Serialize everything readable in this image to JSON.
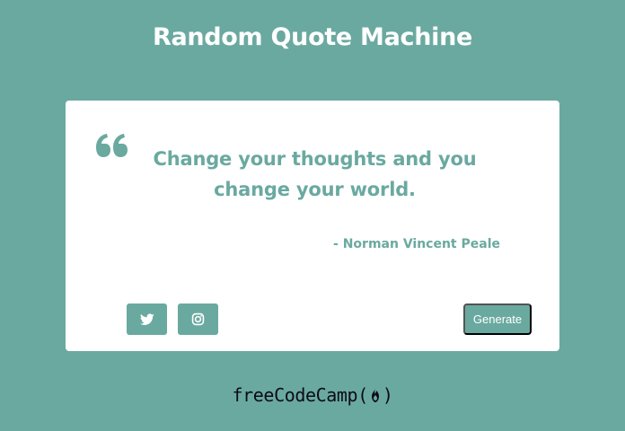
{
  "app": {
    "title": "Random Quote Machine"
  },
  "quote": {
    "text": "Change your thoughts and you change your world.",
    "author": "- Norman Vincent Peale",
    "icon": "quote-left-icon"
  },
  "actions": {
    "twitter_icon": "twitter-icon",
    "instagram_icon": "instagram-icon",
    "generate_label": "Generate"
  },
  "footer": {
    "brand_prefix": "freeCodeCamp(",
    "brand_suffix": ")",
    "icon": "fire-icon"
  },
  "colors": {
    "accent": "#6aa9a0",
    "card": "#ffffff",
    "footer_text": "#0b0b1a"
  }
}
